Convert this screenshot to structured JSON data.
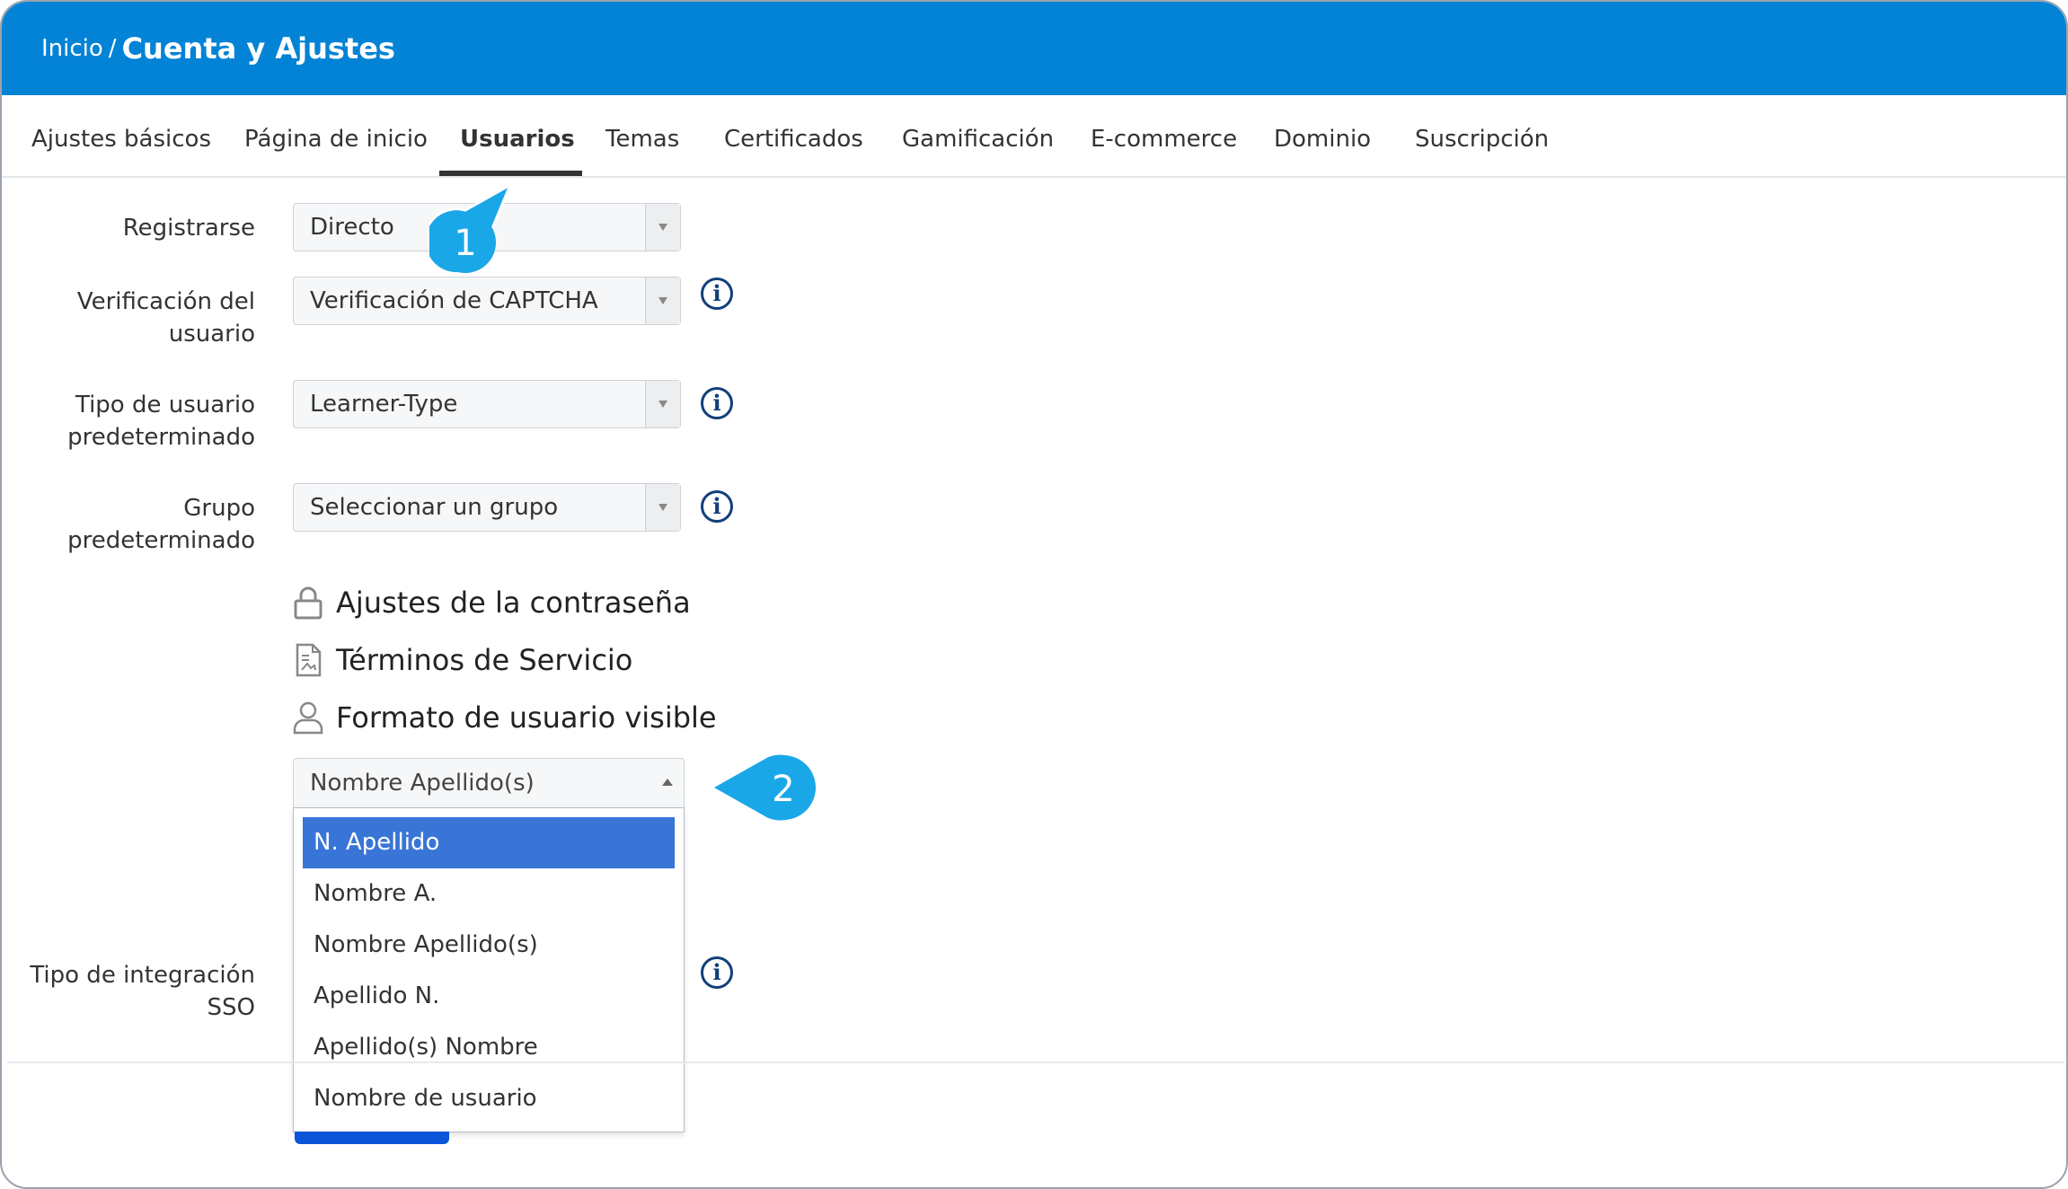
{
  "breadcrumb": {
    "home": "Inicio",
    "separator": "/",
    "current": "Cuenta y Ajustes"
  },
  "tabs": [
    {
      "label": "Ajustes básicos",
      "active": false
    },
    {
      "label": "Página de inicio",
      "active": false
    },
    {
      "label": "Usuarios",
      "active": true
    },
    {
      "label": "Temas",
      "active": false
    },
    {
      "label": "Certificados",
      "active": false
    },
    {
      "label": "Gamificación",
      "active": false
    },
    {
      "label": "E-commerce",
      "active": false
    },
    {
      "label": "Dominio",
      "active": false
    },
    {
      "label": "Suscripción",
      "active": false
    }
  ],
  "form": {
    "register": {
      "label": "Registrarse",
      "value": "Directo"
    },
    "verification": {
      "label_line1": "Verificación del",
      "label_line2": "usuario",
      "value": "Verificación de CAPTCHA"
    },
    "user_type": {
      "label_line1": "Tipo de usuario",
      "label_line2": "predeterminado",
      "value": "Learner-Type"
    },
    "group": {
      "label_line1": "Grupo",
      "label_line2": "predeterminado",
      "value": "Seleccionar un grupo"
    },
    "sso": {
      "label_line1": "Tipo de integración",
      "label_line2": "SSO"
    }
  },
  "sections": {
    "password": "Ajustes de la contraseña",
    "terms": "Términos de Servicio",
    "visible_format": "Formato de usuario visible"
  },
  "format_select": {
    "value": "Nombre Apellido(s)",
    "options": [
      "N. Apellido",
      "Nombre A.",
      "Nombre Apellido(s)",
      "Apellido N.",
      "Apellido(s) Nombre",
      "Nombre de usuario"
    ],
    "highlighted": "N. Apellido"
  },
  "callouts": {
    "one": "1",
    "two": "2"
  },
  "colors": {
    "header": "#0283d6",
    "callout": "#1aa7e8",
    "highlight": "#3875d7",
    "info": "#123f7a"
  },
  "icons": {
    "info": "info-icon",
    "lock": "lock-icon",
    "document": "document-icon",
    "user": "user-icon"
  }
}
